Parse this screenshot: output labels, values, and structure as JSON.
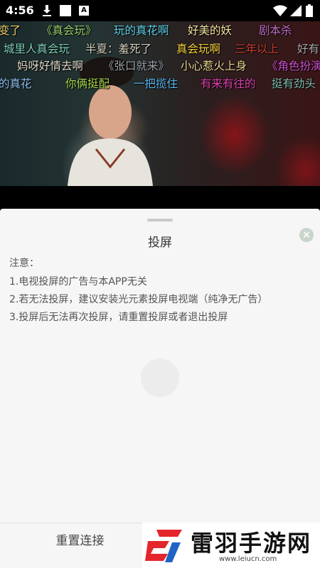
{
  "status_bar": {
    "time": "4:56"
  },
  "video": {
    "danmaku": [
      {
        "text": "变了",
        "color": "#f0d36a"
      },
      {
        "text": "《真会玩》",
        "color": "#9bd06a"
      },
      {
        "text": "玩的真花啊",
        "color": "#5fd3e8"
      },
      {
        "text": "好美的妖",
        "color": "#f7e7a0"
      },
      {
        "text": "剧本杀",
        "color": "#c070c8"
      },
      {
        "text": "城里人真会玩",
        "color": "#7ed2b8"
      },
      {
        "text": "半夏：羞死了",
        "color": "#d8d2c0"
      },
      {
        "text": "真会玩啊",
        "color": "#f5d23a"
      },
      {
        "text": "三年以上",
        "color": "#d04030"
      },
      {
        "text": "好有",
        "color": "#aaaaaa"
      },
      {
        "text": "妈呀好情去啊",
        "color": "#e0d8c8"
      },
      {
        "text": "《张口就来》",
        "color": "#9aa0aa"
      },
      {
        "text": "小心惹火上身",
        "color": "#e8d890"
      },
      {
        "text": "《角色扮演",
        "color": "#d050d0"
      },
      {
        "text": "的真花",
        "color": "#8ec0f0"
      },
      {
        "text": "你俩挺配",
        "color": "#a8d84c"
      },
      {
        "text": "一把揽住",
        "color": "#5cb8f0"
      },
      {
        "text": "有来有往的",
        "color": "#e040b0"
      },
      {
        "text": "挺有劲头",
        "color": "#7fc0b0"
      }
    ]
  },
  "sheet": {
    "title": "投屏",
    "close_icon": "×",
    "notes": [
      "注意：",
      "1.电视投屏的广告与本APP无关",
      "2.若无法投屏，建议安装光元素投屏电视端（纯净无广告）",
      "3.投屏后无法再次投屏，请重置投屏或者退出投屏"
    ],
    "reset_label": "重置连接"
  },
  "watermark": {
    "brand": "雷羽手游网",
    "url": "www.leiucn.com"
  },
  "colors": {
    "sheet_bg": "#f6f6f6",
    "close_icon_bg": "#c8d6cc"
  }
}
